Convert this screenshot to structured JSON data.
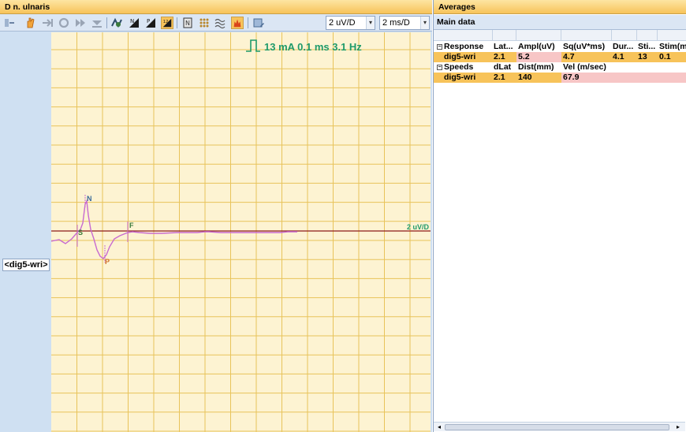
{
  "left_panel": {
    "title": "D n. ulnaris",
    "amplitude_scale": "2 uV/D",
    "time_scale": "2 ms/D",
    "stimulus_readout": "13 mA  0.1 ms 3.1 Hz",
    "trace_label": "<dig5-wri>",
    "trace_scale_label": "2 uV/D",
    "markers": {
      "n": "N",
      "p": "P",
      "s": "S",
      "f": "F"
    },
    "toolbar_icons": [
      "sensitivity-icon",
      "hand-icon",
      "step-forward-icon",
      "loop-icon",
      "fast-forward-icon",
      "down-arrow-icon",
      "averaging-icon",
      "marker-n-icon",
      "marker-p-icon",
      "marker-np-icon",
      "note-icon",
      "grid-dots-icon",
      "waves-icon",
      "fire-icon",
      "settings-icon"
    ],
    "colors": {
      "grid_major": "#e8c35a",
      "grid_minor": "#f3e0a0",
      "plot_bg": "#fdf3d2",
      "trace": "#c86bd0",
      "baseline": "#8b1a1a",
      "stim_text": "#1e9a6a"
    }
  },
  "right_panel": {
    "title": "Averages",
    "section_title": "Main data",
    "response_group": {
      "headers": [
        "Response",
        "Lat...",
        "Ampl(uV)",
        "Sq(uV*ms)",
        "Dur...",
        "Sti...",
        "Stim(m"
      ],
      "row": [
        "dig5-wri",
        "2.1",
        "5.2",
        "4.7",
        "4.1",
        "13",
        "0.1"
      ]
    },
    "speeds_group": {
      "headers": [
        "Speeds",
        "dLat",
        "Dist(mm)",
        "Vel (m/sec)"
      ],
      "row": [
        "dig5-wri",
        "2.1",
        "140",
        "67.9"
      ]
    }
  }
}
